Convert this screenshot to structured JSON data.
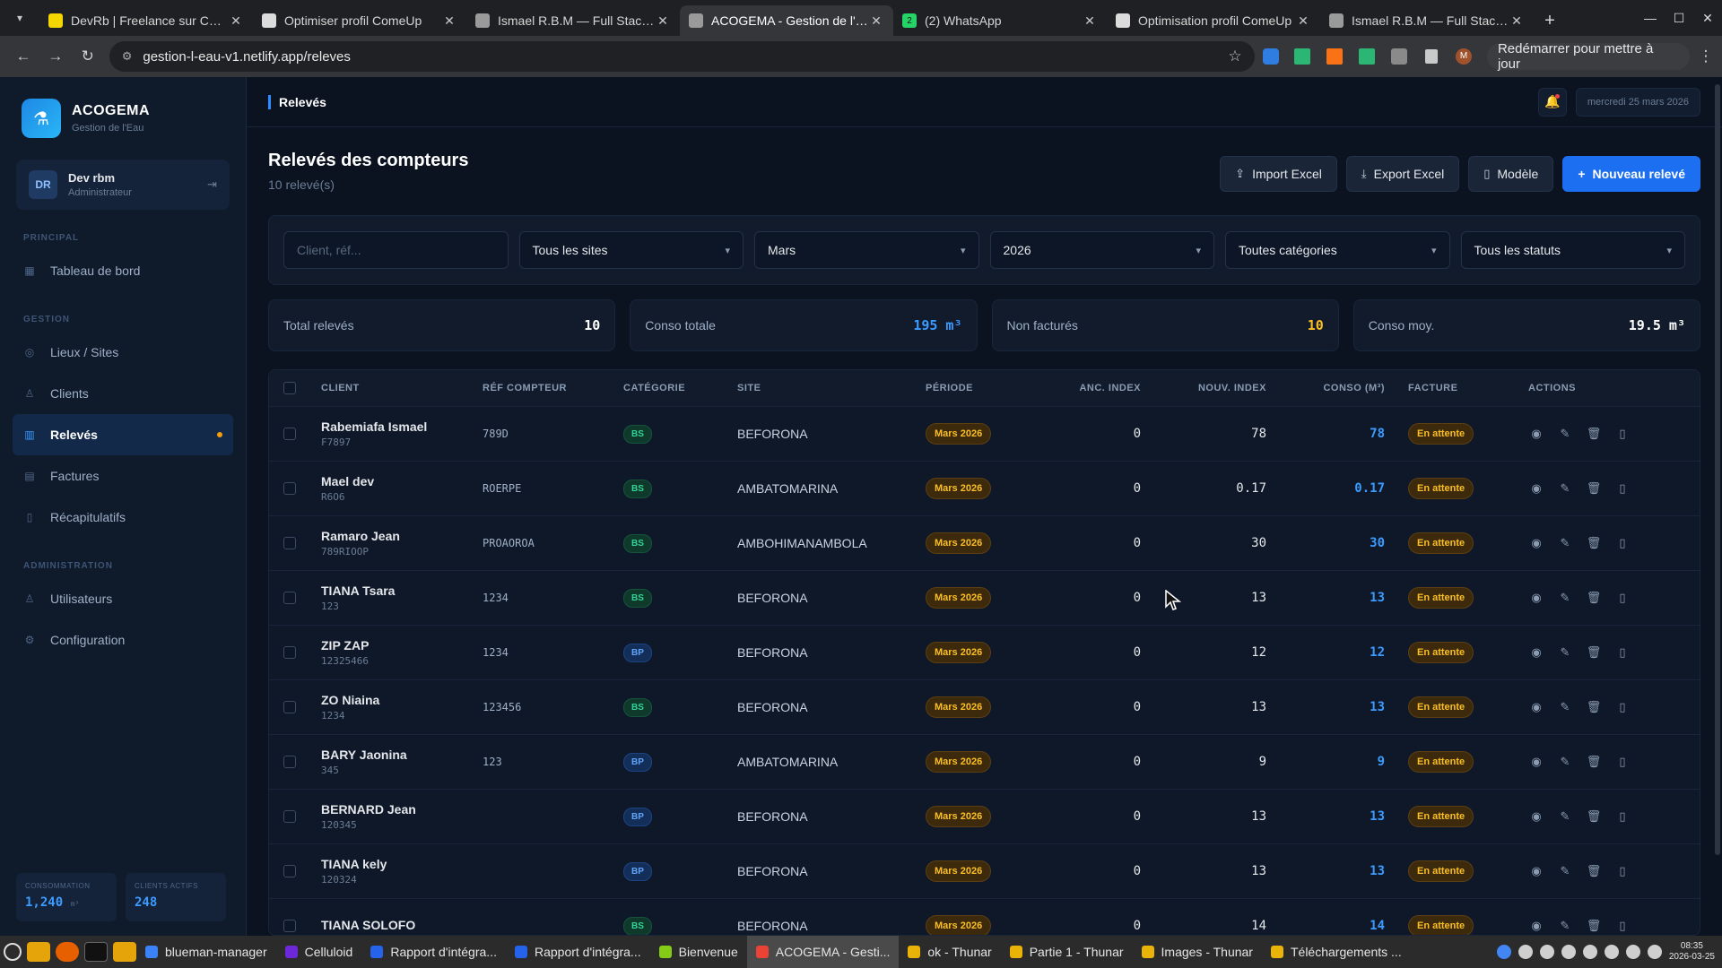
{
  "browser": {
    "tabs": [
      {
        "title": "DevRb | Freelance sur ComeUp",
        "favicon_color": "#f5d600"
      },
      {
        "title": "Optimiser profil ComeUp",
        "favicon_color": "#dcdcdc"
      },
      {
        "title": "Ismael R.B.M — Full Stack Dev",
        "favicon_color": "#9a9a9a"
      },
      {
        "title": "ACOGEMA - Gestion de l'Eau",
        "favicon_color": "#9a9a9a",
        "active": true
      },
      {
        "title": "(2) WhatsApp",
        "favicon_color": "#25d366",
        "badge": "2"
      },
      {
        "title": "Optimisation profil ComeUp",
        "favicon_color": "#dcdcdc"
      },
      {
        "title": "Ismael R.B.M — Full Stack Dev",
        "favicon_color": "#9a9a9a"
      }
    ],
    "url": "gestion-l-eau-v1.netlify.app/releves",
    "restart_label": "Redémarrer pour mettre à jour",
    "profile_initial": "M"
  },
  "app": {
    "brand": {
      "name": "ACOGEMA",
      "subtitle": "Gestion de l'Eau"
    },
    "user": {
      "initials": "DR",
      "name": "Dev rbm",
      "role": "Administrateur"
    },
    "sections": {
      "principal": "PRINCIPAL",
      "gestion": "GESTION",
      "administration": "ADMINISTRATION"
    },
    "nav": {
      "dashboard": "Tableau de bord",
      "lieux": "Lieux / Sites",
      "clients": "Clients",
      "releves": "Relevés",
      "factures": "Factures",
      "recap": "Récapitulatifs",
      "utilisateurs": "Utilisateurs",
      "config": "Configuration"
    },
    "side_stats": {
      "conso_label": "CONSOMMATION",
      "conso_value": "1,240",
      "conso_unit": "m³",
      "clients_label": "CLIENTS ACTIFS",
      "clients_value": "248"
    },
    "breadcrumb": "Relevés",
    "date": "mercredi 25 mars 2026",
    "page": {
      "title": "Relevés des compteurs",
      "count": "10 relevé(s)"
    },
    "buttons": {
      "import": "Import Excel",
      "export": "Export Excel",
      "template": "Modèle",
      "new": "Nouveau relevé"
    },
    "filters": {
      "search_placeholder": "Client, réf...",
      "site": "Tous les sites",
      "month": "Mars",
      "year": "2026",
      "category": "Toutes catégories",
      "status": "Tous les statuts"
    },
    "stats": [
      {
        "label": "Total relevés",
        "value": "10",
        "color": "#ffffff"
      },
      {
        "label": "Conso totale",
        "value": "195 m³",
        "color": "#3b9bff"
      },
      {
        "label": "Non facturés",
        "value": "10",
        "color": "#fbbf24"
      },
      {
        "label": "Conso moy.",
        "value": "19.5 m³",
        "color": "#ffffff"
      }
    ],
    "table": {
      "headers": {
        "client": "CLIENT",
        "ref": "RÉF COMPTEUR",
        "cat": "CATÉGORIE",
        "site": "SITE",
        "period": "PÉRIODE",
        "anc": "ANC. INDEX",
        "nouv": "NOUV. INDEX",
        "conso": "CONSO (M³)",
        "facture": "FACTURE",
        "actions": "ACTIONS"
      },
      "rows": [
        {
          "name": "Rabemiafa Ismael",
          "sub": "F7897",
          "ref": "789D",
          "cat": "BS",
          "site": "BEFORONA",
          "period": "Mars 2026",
          "anc": "0",
          "nouv": "78",
          "conso": "78",
          "facture": "En attente"
        },
        {
          "name": "Mael dev",
          "sub": "R6O6",
          "ref": "ROERPE",
          "cat": "BS",
          "site": "AMBATOMARINA",
          "period": "Mars 2026",
          "anc": "0",
          "nouv": "0.17",
          "conso": "0.17",
          "facture": "En attente"
        },
        {
          "name": "Ramaro Jean",
          "sub": "789RIOOP",
          "ref": "PROAOROA",
          "cat": "BS",
          "site": "AMBOHIMANAMBOLA",
          "period": "Mars 2026",
          "anc": "0",
          "nouv": "30",
          "conso": "30",
          "facture": "En attente"
        },
        {
          "name": "TIANA Tsara",
          "sub": "123",
          "ref": "1234",
          "cat": "BS",
          "site": "BEFORONA",
          "period": "Mars 2026",
          "anc": "0",
          "nouv": "13",
          "conso": "13",
          "facture": "En attente"
        },
        {
          "name": "ZIP ZAP",
          "sub": "12325466",
          "ref": "1234",
          "cat": "BP",
          "site": "BEFORONA",
          "period": "Mars 2026",
          "anc": "0",
          "nouv": "12",
          "conso": "12",
          "facture": "En attente"
        },
        {
          "name": "ZO Niaina",
          "sub": "1234",
          "ref": "123456",
          "cat": "BS",
          "site": "BEFORONA",
          "period": "Mars 2026",
          "anc": "0",
          "nouv": "13",
          "conso": "13",
          "facture": "En attente"
        },
        {
          "name": "BARY Jaonina",
          "sub": "345",
          "ref": "123",
          "cat": "BP",
          "site": "AMBATOMARINA",
          "period": "Mars 2026",
          "anc": "0",
          "nouv": "9",
          "conso": "9",
          "facture": "En attente"
        },
        {
          "name": "BERNARD Jean",
          "sub": "120345",
          "ref": "",
          "cat": "BP",
          "site": "BEFORONA",
          "period": "Mars 2026",
          "anc": "0",
          "nouv": "13",
          "conso": "13",
          "facture": "En attente"
        },
        {
          "name": "TIANA kely",
          "sub": "120324",
          "ref": "",
          "cat": "BP",
          "site": "BEFORONA",
          "period": "Mars 2026",
          "anc": "0",
          "nouv": "13",
          "conso": "13",
          "facture": "En attente"
        },
        {
          "name": "TIANA SOLOFO",
          "sub": "",
          "ref": "",
          "cat": "BS",
          "site": "BEFORONA",
          "period": "Mars 2026",
          "anc": "0",
          "nouv": "14",
          "conso": "14",
          "facture": "En attente"
        }
      ]
    }
  },
  "taskbar": {
    "items": [
      {
        "label": "blueman-manager",
        "color": "#3b82f6"
      },
      {
        "label": "Celluloid",
        "color": "#6d28d9"
      },
      {
        "label": "Rapport d'intégra...",
        "color": "#2563eb"
      },
      {
        "label": "Rapport d'intégra...",
        "color": "#2563eb"
      },
      {
        "label": "Bienvenue",
        "color": "#84cc16"
      },
      {
        "label": "ACOGEMA - Gesti...",
        "color": "#ea4335",
        "active": true
      },
      {
        "label": "ok - Thunar",
        "color": "#eab308"
      },
      {
        "label": "Partie 1 - Thunar",
        "color": "#eab308"
      },
      {
        "label": "Images - Thunar",
        "color": "#eab308"
      },
      {
        "label": "Téléchargements ...",
        "color": "#eab308"
      }
    ],
    "time": "08:35",
    "date": "2026-03-25"
  }
}
